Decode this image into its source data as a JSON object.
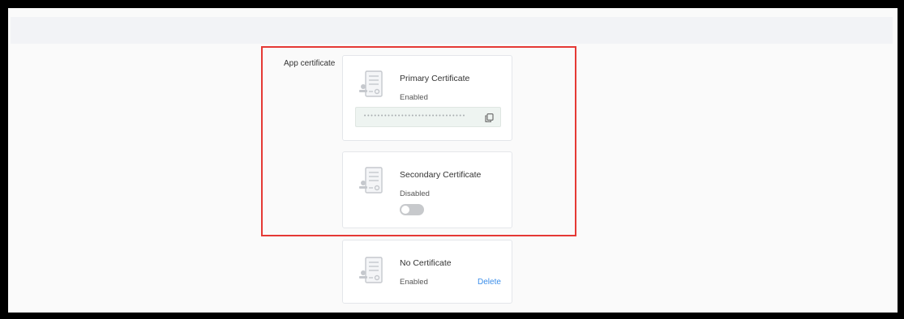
{
  "section": {
    "label": "App certificate"
  },
  "certificates": [
    {
      "title": "Primary Certificate",
      "status": "Enabled",
      "secret": "••••••••••••••••••••••••••••••"
    },
    {
      "title": "Secondary Certificate",
      "status": "Disabled",
      "toggle_on": false
    },
    {
      "title": "No Certificate",
      "status": "Enabled",
      "action": "Delete"
    }
  ],
  "colors": {
    "accent_link": "#3b8eea",
    "highlight_border": "#e53935",
    "toggle_off": "#c7c9cc"
  },
  "icons": {
    "certificate": "certificate-document-icon",
    "copy": "copy-icon"
  }
}
